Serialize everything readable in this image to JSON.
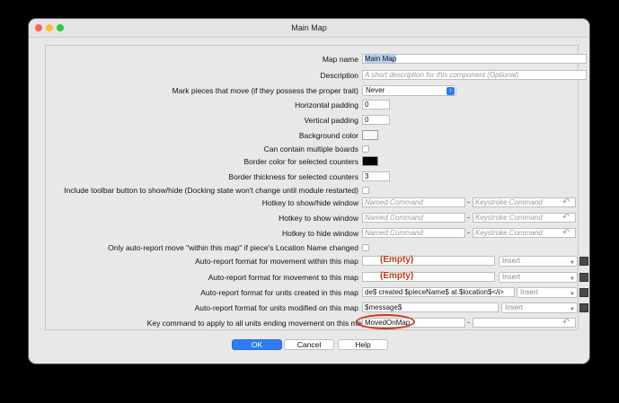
{
  "window": {
    "title": "Main Map"
  },
  "fields": {
    "map_name": {
      "label": "Map name",
      "value": "Main Map"
    },
    "description": {
      "label": "Description",
      "placeholder": "A short description for this component (Optional)"
    },
    "mark_pieces": {
      "label": "Mark pieces that move (if they possess the proper trait)",
      "value": "Never"
    },
    "h_padding": {
      "label": "Horizontal padding",
      "value": "0"
    },
    "v_padding": {
      "label": "Vertical padding",
      "value": "0"
    },
    "bg_color": {
      "label": "Background color",
      "color": "#f8f8f8"
    },
    "multi_boards": {
      "label": "Can contain multiple boards"
    },
    "border_color": {
      "label": "Border color for selected counters",
      "color": "#000000"
    },
    "border_thickness": {
      "label": "Border thickness for selected counters",
      "value": "3"
    },
    "toolbar_button": {
      "label": "Include toolbar button to show/hide (Docking state won't change until module restarted)"
    },
    "hk_showhide": {
      "label": "Hotkey to show/hide window",
      "named_ph": "Named Command",
      "key_ph": "Keystroke Command"
    },
    "hk_show": {
      "label": "Hotkey to show window",
      "named_ph": "Named Command",
      "key_ph": "Keystroke Command"
    },
    "hk_hide": {
      "label": "Hotkey to hide window",
      "named_ph": "Named Command",
      "key_ph": "Keystroke Command"
    },
    "only_auto": {
      "label": "Only auto-report move \"within this map\" if piece's Location Name changed"
    },
    "ar_within": {
      "label": "Auto-report format for movement within this map",
      "value": "",
      "insert": "Insert",
      "note": "(Empty)"
    },
    "ar_to": {
      "label": "Auto-report format for movement to this map",
      "value": "",
      "insert": "Insert",
      "note": "(Empty)"
    },
    "ar_created": {
      "label": "Auto-report format for units created in this map",
      "value": "de$ created $pieceName$ at $location$</i>",
      "insert": "Insert"
    },
    "ar_modified": {
      "label": "Auto-report format for units modified on this map",
      "value": "$message$",
      "insert": "Insert"
    },
    "key_cmd": {
      "label": "Key command to apply to all units ending movement on this map",
      "value": "MovedOnMap",
      "key_value": ""
    }
  },
  "buttons": {
    "ok": "OK",
    "cancel": "Cancel",
    "help": "Help"
  },
  "icons": {
    "undo": "undo-arrow-icon",
    "dropdown": "chevron-down-icon",
    "format": "format-editor-icon"
  },
  "colors": {
    "accent": "#2f7cf6",
    "annotation": "#d2361c"
  }
}
